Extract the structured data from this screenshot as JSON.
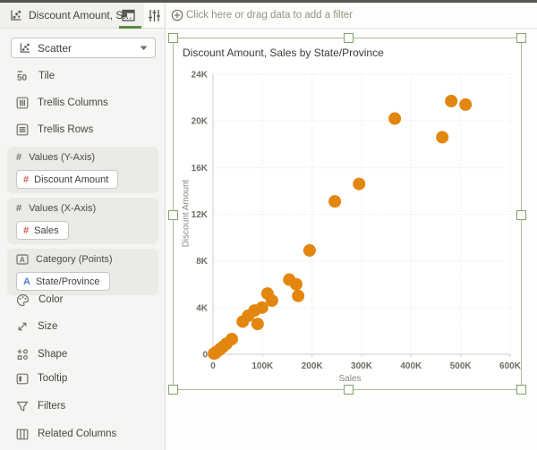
{
  "header": {
    "title": "Discount Amount, S...",
    "tabs": [
      {
        "name": "grammar",
        "active": true
      },
      {
        "name": "properties",
        "active": false
      }
    ]
  },
  "filter_bar": {
    "text": "Click here or drag data to add a filter"
  },
  "grammar_panel": {
    "chart_type": {
      "label": "Scatter"
    },
    "items_top": [
      {
        "label": "Tile",
        "icon": "tile-icon"
      },
      {
        "label": "Trellis Columns",
        "icon": "trellis-columns-icon"
      },
      {
        "label": "Trellis Rows",
        "icon": "trellis-rows-icon"
      }
    ],
    "drop_zones": [
      {
        "label": "Values (Y-Axis)",
        "icon": "number",
        "pills": [
          {
            "label": "Discount Amount",
            "icon": "number"
          }
        ]
      },
      {
        "label": "Values (X-Axis)",
        "icon": "number",
        "pills": [
          {
            "label": "Sales",
            "icon": "number"
          }
        ]
      },
      {
        "label": "Category (Points)",
        "icon": "letter",
        "pills": [
          {
            "label": "State/Province",
            "icon": "letter"
          }
        ]
      }
    ],
    "items_bottom": [
      {
        "label": "Color",
        "icon": "color-icon"
      },
      {
        "label": "Size",
        "icon": "size-icon"
      },
      {
        "label": "Shape",
        "icon": "shape-icon"
      },
      {
        "label": "Tooltip",
        "icon": "tooltip-icon"
      },
      {
        "label": "Filters",
        "icon": "filters-icon"
      },
      {
        "label": "Related Columns",
        "icon": "related-columns-icon"
      }
    ]
  },
  "chart_data": {
    "type": "scatter",
    "title": "Discount Amount, Sales by State/Province",
    "xlabel": "Sales",
    "ylabel": "Discount Amount",
    "xlim": [
      0,
      600000
    ],
    "ylim": [
      0,
      24000
    ],
    "grid": true,
    "point_color": "#e2860f",
    "x_ticks": [
      {
        "v": 0,
        "label": "0"
      },
      {
        "v": 100000,
        "label": "100K"
      },
      {
        "v": 200000,
        "label": "200K"
      },
      {
        "v": 300000,
        "label": "300K"
      },
      {
        "v": 400000,
        "label": "400K"
      },
      {
        "v": 500000,
        "label": "500K"
      },
      {
        "v": 600000,
        "label": "600K"
      }
    ],
    "y_ticks": [
      {
        "v": 0,
        "label": "0"
      },
      {
        "v": 4000,
        "label": "4K"
      },
      {
        "v": 8000,
        "label": "8K"
      },
      {
        "v": 12000,
        "label": "12K"
      },
      {
        "v": 16000,
        "label": "16K"
      },
      {
        "v": 20000,
        "label": "20K"
      },
      {
        "v": 24000,
        "label": "24K"
      }
    ],
    "points": [
      [
        2000,
        60
      ],
      [
        5000,
        120
      ],
      [
        9000,
        260
      ],
      [
        14000,
        430
      ],
      [
        20000,
        640
      ],
      [
        27000,
        900
      ],
      [
        38000,
        1300
      ],
      [
        60000,
        2800
      ],
      [
        71000,
        3300
      ],
      [
        84000,
        3750
      ],
      [
        90000,
        2600
      ],
      [
        99000,
        4000
      ],
      [
        110000,
        5200
      ],
      [
        119000,
        4600
      ],
      [
        154000,
        6400
      ],
      [
        168000,
        6000
      ],
      [
        172000,
        5000
      ],
      [
        195000,
        8900
      ],
      [
        246000,
        13100
      ],
      [
        295000,
        14600
      ],
      [
        367000,
        20200
      ],
      [
        463000,
        18600
      ],
      [
        481000,
        21700
      ],
      [
        510000,
        21400
      ]
    ]
  },
  "colors": {
    "accent_green": "#5b8a47",
    "selection_green": "#a9bc97",
    "point_orange": "#e2860f",
    "measure_red": "#cf5b4a",
    "attribute_blue": "#4f7ec2"
  }
}
